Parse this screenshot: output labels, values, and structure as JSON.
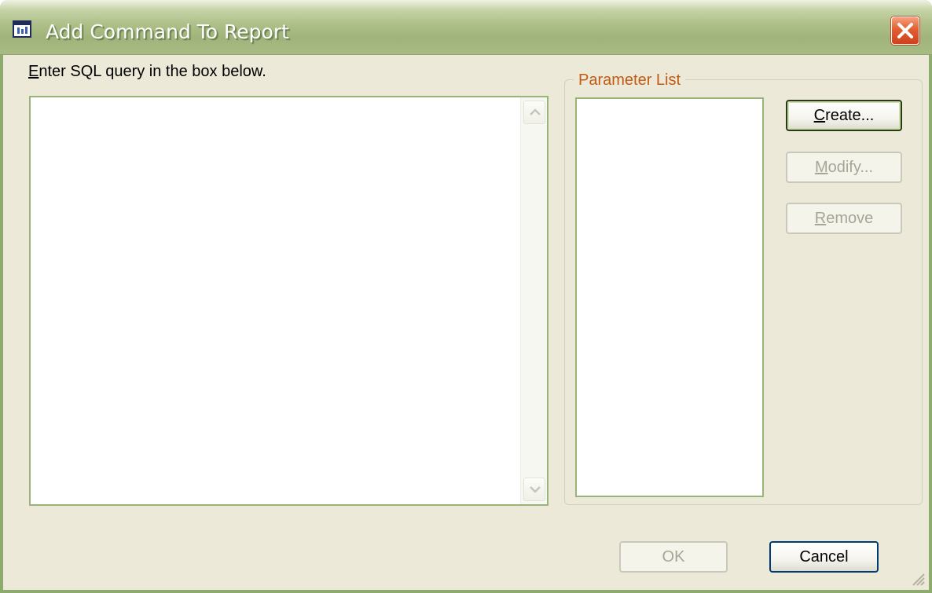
{
  "window": {
    "title": "Add Command To Report",
    "title_icon": "report-icon",
    "close_icon": "close-icon"
  },
  "sql": {
    "label": "Enter SQL query in the box below.",
    "label_mnemonic": "E",
    "label_rest": "nter SQL query in the box below.",
    "value": ""
  },
  "parameters": {
    "group_label": "Parameter List",
    "items": [],
    "create_label": "Create...",
    "create_mnemonic": "C",
    "create_rest": "reate...",
    "modify_label": "Modify...",
    "modify_mnemonic": "M",
    "modify_rest": "odify...",
    "remove_label": "Remove",
    "remove_mnemonic": "R",
    "remove_rest": "emove"
  },
  "footer": {
    "ok_label": "OK",
    "cancel_label": "Cancel"
  },
  "colors": {
    "title_green": "#9fb47a",
    "face": "#ece9d8",
    "group_label": "#c25a14",
    "close_red": "#e45d31"
  }
}
